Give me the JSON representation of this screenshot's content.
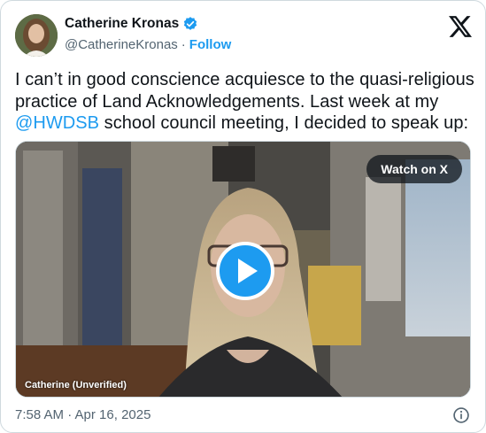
{
  "author": {
    "display_name": "Catherine Kronas",
    "handle": "@CatherineKronas",
    "separator": "·",
    "follow_label": "Follow",
    "verified": true
  },
  "tweet": {
    "text_part1": "I can’t in good conscience acquiesce to the quasi-religious practice of Land Acknowledgements. Last week at my ",
    "mention": "@HWDSB",
    "text_part2": " school council meeting, I decided to speak up:"
  },
  "video": {
    "watch_label": "Watch on X",
    "caption": "Catherine (Unverified)"
  },
  "footer": {
    "timestamp": "7:58 AM · Apr 16, 2025"
  },
  "colors": {
    "accent": "#1d9bf0",
    "text": "#0f1419",
    "muted": "#536471",
    "border": "#cfd9de"
  },
  "icons": {
    "brand": "x-logo-icon",
    "verified": "verified-badge-icon",
    "play": "play-icon",
    "info": "info-icon"
  }
}
